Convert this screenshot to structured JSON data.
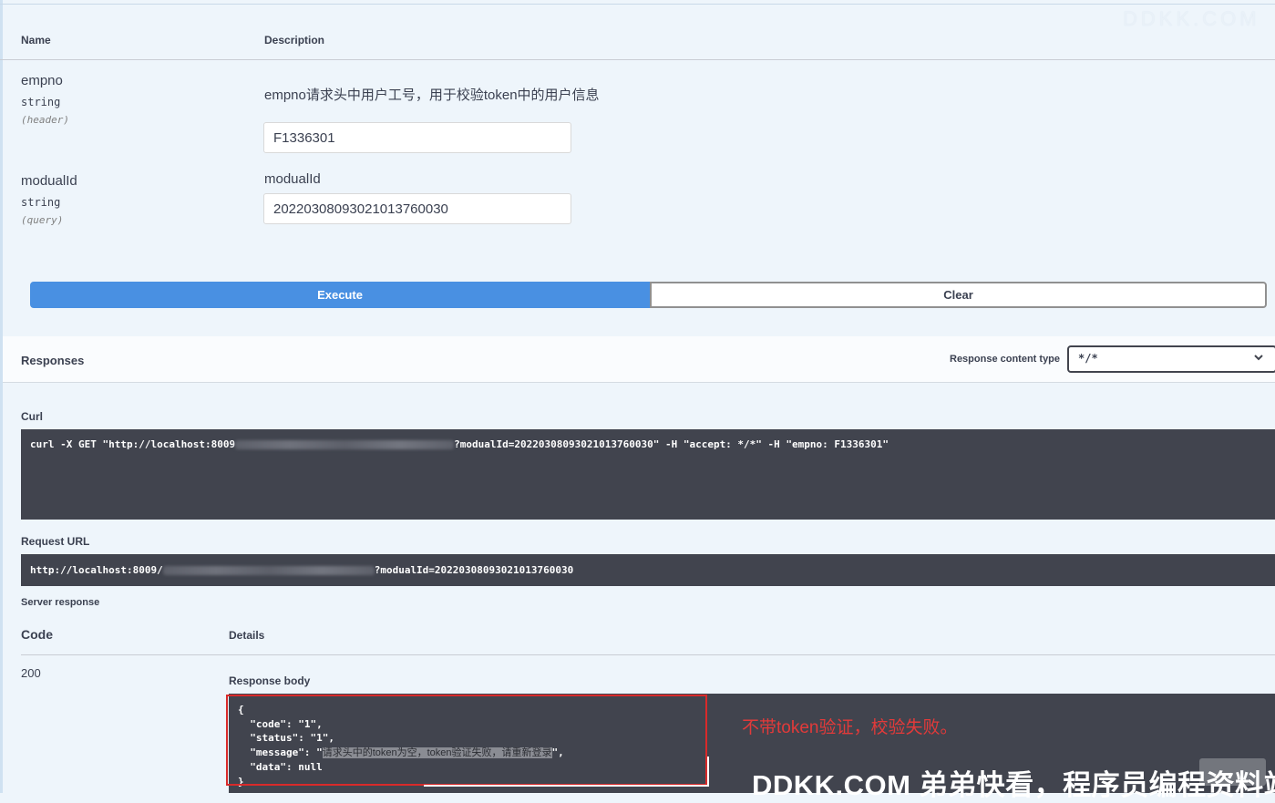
{
  "faint_watermark": "DDKK.COM",
  "params": {
    "header": {
      "name": "Name",
      "description": "Description"
    },
    "items": [
      {
        "name": "empno",
        "type": "string",
        "in": "(header)",
        "description": "empno请求头中用户工号，用于校验token中的用户信息",
        "value": "F1336301"
      },
      {
        "name": "modualId",
        "type": "string",
        "in": "(query)",
        "description": "modualId",
        "value": "20220308093021013760030"
      }
    ]
  },
  "buttons": {
    "execute": "Execute",
    "clear": "Clear"
  },
  "responses": {
    "title": "Responses",
    "content_type_label": "Response content type",
    "content_type_value": "*/*"
  },
  "curl": {
    "label": "Curl",
    "prefix": "curl -X GET \"http://localhost:8009",
    "suffix": "?modualId=20220308093021013760030\" -H \"accept: */*\" -H \"empno: F1336301\""
  },
  "request_url": {
    "label": "Request URL",
    "prefix": "http://localhost:8009/",
    "suffix": "?modualId=20220308093021013760030"
  },
  "server_response": {
    "label": "Server response",
    "code_header": "Code",
    "details_header": "Details",
    "code": "200",
    "body_label": "Response body",
    "body": {
      "open": "{",
      "code_line": "  \"code\": \"1\",",
      "status_line": "  \"status\": \"1\",",
      "message_prefix": "  \"message\": \"",
      "message": "请求头中的token为空，token验证失败，请重新登录",
      "message_suffix": "\",",
      "data_line": "  \"data\": null",
      "close": "}"
    }
  },
  "annotation": "不带token验证，校验失败。",
  "watermark": "DDKK.COM 弟弟快看，程序员编程资料站"
}
